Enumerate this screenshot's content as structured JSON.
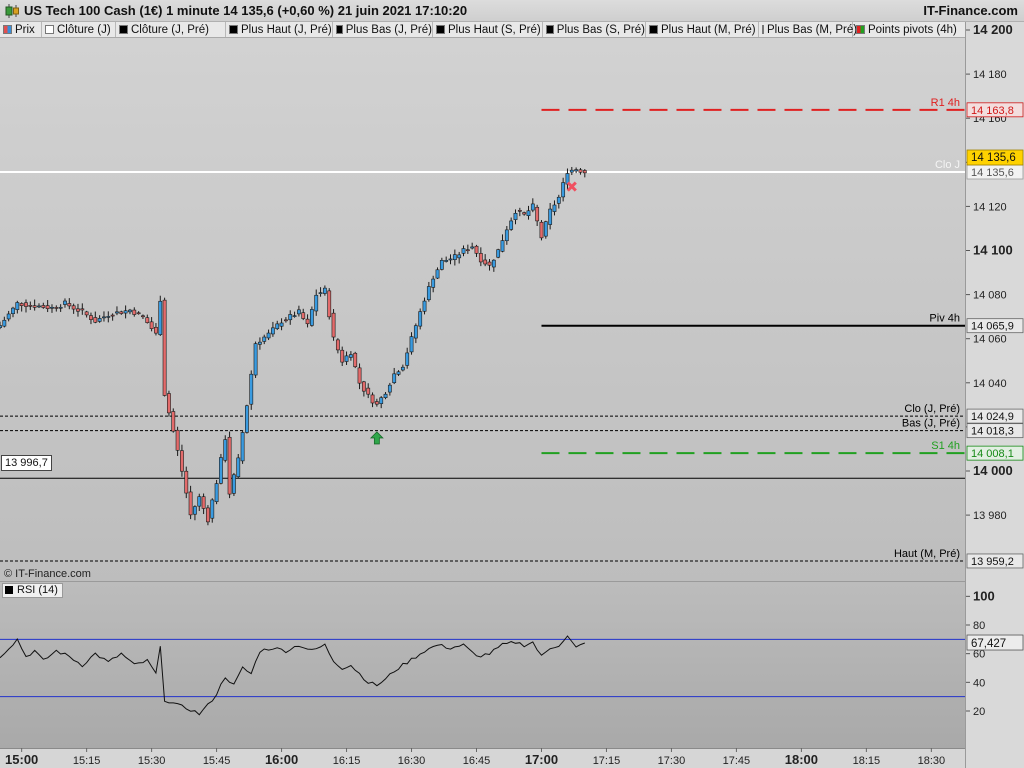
{
  "window": {
    "title": "US Tech 100 Cash (1€) 1 minute 14 135,6 (+0,60 %) 21 juin 2021 17:10:20",
    "brand": "IT-Finance.com",
    "copyright": "© IT-Finance.com"
  },
  "legend": [
    {
      "label": "Prix",
      "color": "#e05050",
      "color2": "#3a8fd8"
    },
    {
      "label": "Clôture (J)",
      "color": "#ffffff"
    },
    {
      "label": "Clôture (J, Pré)",
      "color": "#000000"
    },
    {
      "label": "Plus Haut (J, Pré)",
      "color": "#000000"
    },
    {
      "label": "Plus Bas (J, Pré)",
      "color": "#000000"
    },
    {
      "label": "Plus Haut (S, Pré)",
      "color": "#000000"
    },
    {
      "label": "Plus Bas (S, Pré)",
      "color": "#000000"
    },
    {
      "label": "Plus Haut (M, Pré)",
      "color": "#000000"
    },
    {
      "label": "Plus Bas (M, Pré)",
      "color": "#000000"
    },
    {
      "label": "Points pivots (4h)",
      "color": "#e02020",
      "color2": "#20a020"
    }
  ],
  "cursor_value": "13 996,7",
  "chart_data": [
    {
      "type": "candlestick",
      "series_name": "Prix",
      "x_unit": "time (HH:MM), 1 minute candles, 21 juin 2021",
      "ylim": [
        13950,
        14205
      ],
      "y_ticks": [
        13980,
        14000,
        14020,
        14040,
        14060,
        14080,
        14100,
        14120,
        14140,
        14160,
        14180,
        14200
      ],
      "y_tick_labels": [
        "13 980",
        "14 000",
        "14 020",
        "14 040",
        "14 060",
        "14 080",
        "14 100",
        "14 120",
        "14 140",
        "14 160",
        "14 180",
        "14 200"
      ],
      "x_range": [
        "14:55",
        "18:38"
      ],
      "x_ticks": [
        "15:00",
        "15:15",
        "15:30",
        "15:45",
        "16:00",
        "16:15",
        "16:30",
        "16:45",
        "17:00",
        "17:15",
        "17:30",
        "17:45",
        "18:00",
        "18:15",
        "18:30"
      ],
      "x_ticks_bold": [
        "15:00",
        "16:00",
        "17:00",
        "18:00"
      ],
      "anchors": [
        {
          "t": "14:55",
          "c": 14066
        },
        {
          "t": "14:59",
          "c": 14076
        },
        {
          "t": "15:03",
          "c": 14075
        },
        {
          "t": "15:07",
          "c": 14074
        },
        {
          "t": "15:10",
          "c": 14076
        },
        {
          "t": "15:14",
          "c": 14072
        },
        {
          "t": "15:17",
          "c": 14068
        },
        {
          "t": "15:20",
          "c": 14071
        },
        {
          "t": "15:25",
          "c": 14073
        },
        {
          "t": "15:28",
          "c": 14070
        },
        {
          "t": "15:31",
          "c": 14062
        },
        {
          "t": "15:32",
          "c": 14078
        },
        {
          "t": "15:33",
          "c": 14035
        },
        {
          "t": "15:35",
          "c": 14018
        },
        {
          "t": "15:37",
          "c": 14000
        },
        {
          "t": "15:39",
          "c": 13980
        },
        {
          "t": "15:41",
          "c": 13988
        },
        {
          "t": "15:43",
          "c": 13978
        },
        {
          "t": "15:45",
          "c": 13995
        },
        {
          "t": "15:47",
          "c": 14015
        },
        {
          "t": "15:48",
          "c": 13990
        },
        {
          "t": "15:50",
          "c": 14005
        },
        {
          "t": "15:52",
          "c": 14030
        },
        {
          "t": "15:54",
          "c": 14058
        },
        {
          "t": "15:57",
          "c": 14062
        },
        {
          "t": "16:00",
          "c": 14068
        },
        {
          "t": "16:04",
          "c": 14072
        },
        {
          "t": "16:06",
          "c": 14066
        },
        {
          "t": "16:08",
          "c": 14080
        },
        {
          "t": "16:10",
          "c": 14082
        },
        {
          "t": "16:12",
          "c": 14060
        },
        {
          "t": "16:14",
          "c": 14050
        },
        {
          "t": "16:16",
          "c": 14054
        },
        {
          "t": "16:18",
          "c": 14040
        },
        {
          "t": "16:20",
          "c": 14034
        },
        {
          "t": "16:22",
          "c": 14030
        },
        {
          "t": "16:24",
          "c": 14036
        },
        {
          "t": "16:26",
          "c": 14044
        },
        {
          "t": "16:28",
          "c": 14048
        },
        {
          "t": "16:30",
          "c": 14060
        },
        {
          "t": "16:33",
          "c": 14078
        },
        {
          "t": "16:35",
          "c": 14088
        },
        {
          "t": "16:37",
          "c": 14095
        },
        {
          "t": "16:40",
          "c": 14097
        },
        {
          "t": "16:42",
          "c": 14100
        },
        {
          "t": "16:44",
          "c": 14102
        },
        {
          "t": "16:46",
          "c": 14096
        },
        {
          "t": "16:48",
          "c": 14093
        },
        {
          "t": "16:50",
          "c": 14100
        },
        {
          "t": "16:52",
          "c": 14110
        },
        {
          "t": "16:54",
          "c": 14118
        },
        {
          "t": "16:56",
          "c": 14116
        },
        {
          "t": "16:58",
          "c": 14120
        },
        {
          "t": "17:00",
          "c": 14106
        },
        {
          "t": "17:02",
          "c": 14118
        },
        {
          "t": "17:04",
          "c": 14124
        },
        {
          "t": "17:06",
          "c": 14136
        },
        {
          "t": "17:08",
          "c": 14137
        },
        {
          "t": "17:10",
          "c": 14135.6
        }
      ],
      "horizontal_levels": [
        {
          "name": "R1 4h",
          "value": 14163.8,
          "value_label": "14 163,8",
          "color": "#e02020",
          "style": "dashed-thick",
          "from": "17:00"
        },
        {
          "name": "Clo J",
          "value": 14135.6,
          "value_label": "14 135,6",
          "color": "#ffffff",
          "style": "solid"
        },
        {
          "name": "Piv 4h",
          "value": 14065.9,
          "value_label": "14 065,9",
          "color": "#000000",
          "style": "solid",
          "from": "17:00"
        },
        {
          "name": "Clo (J, Pré)",
          "value": 14024.9,
          "value_label": "14 024,9",
          "color": "#000000",
          "style": "dashed-thin"
        },
        {
          "name": "Bas (J, Pré)",
          "value": 14018.3,
          "value_label": "14 018,3",
          "color": "#000000",
          "style": "dashed-thin"
        },
        {
          "name": "S1 4h",
          "value": 14008.1,
          "value_label": "14 008,1",
          "color": "#20a020",
          "style": "dashed-thick",
          "from": "17:00"
        },
        {
          "name": "Haut (M, Pré)",
          "value": 13959.2,
          "value_label": "13 959,2",
          "color": "#000000",
          "style": "dashed-thin"
        }
      ],
      "cursor_line": 13996.7,
      "last_price_label": "14 135,6",
      "signals": [
        {
          "type": "buy-arrow",
          "t": "16:22",
          "value": 14015
        },
        {
          "type": "sell-cross",
          "t": "17:07",
          "value": 14129
        }
      ]
    },
    {
      "type": "line",
      "series_name": "RSI (14)",
      "ylim": [
        0,
        100
      ],
      "y_ticks": [
        20,
        40,
        60,
        80,
        100
      ],
      "y_tick_labels": [
        "20",
        "40",
        "60",
        "80",
        "100"
      ],
      "bands": [
        30,
        70
      ],
      "last_value": 67.427,
      "last_value_label": "67,427",
      "anchors": [
        {
          "t": "14:55",
          "v": 58
        },
        {
          "t": "14:57",
          "v": 64
        },
        {
          "t": "14:59",
          "v": 70
        },
        {
          "t": "15:01",
          "v": 58
        },
        {
          "t": "15:03",
          "v": 62
        },
        {
          "t": "15:05",
          "v": 55
        },
        {
          "t": "15:08",
          "v": 62
        },
        {
          "t": "15:11",
          "v": 58
        },
        {
          "t": "15:14",
          "v": 52
        },
        {
          "t": "15:17",
          "v": 60
        },
        {
          "t": "15:20",
          "v": 54
        },
        {
          "t": "15:23",
          "v": 60
        },
        {
          "t": "15:26",
          "v": 52
        },
        {
          "t": "15:29",
          "v": 55
        },
        {
          "t": "15:31",
          "v": 46
        },
        {
          "t": "15:32",
          "v": 64
        },
        {
          "t": "15:33",
          "v": 28
        },
        {
          "t": "15:36",
          "v": 24
        },
        {
          "t": "15:39",
          "v": 21
        },
        {
          "t": "15:41",
          "v": 18
        },
        {
          "t": "15:43",
          "v": 24
        },
        {
          "t": "15:45",
          "v": 32
        },
        {
          "t": "15:47",
          "v": 44
        },
        {
          "t": "15:49",
          "v": 38
        },
        {
          "t": "15:51",
          "v": 50
        },
        {
          "t": "15:53",
          "v": 46
        },
        {
          "t": "15:55",
          "v": 62
        },
        {
          "t": "15:58",
          "v": 64
        },
        {
          "t": "16:01",
          "v": 62
        },
        {
          "t": "16:04",
          "v": 66
        },
        {
          "t": "16:07",
          "v": 62
        },
        {
          "t": "16:10",
          "v": 66
        },
        {
          "t": "16:12",
          "v": 55
        },
        {
          "t": "16:14",
          "v": 50
        },
        {
          "t": "16:16",
          "v": 52
        },
        {
          "t": "16:18",
          "v": 46
        },
        {
          "t": "16:20",
          "v": 40
        },
        {
          "t": "16:22",
          "v": 38
        },
        {
          "t": "16:24",
          "v": 42
        },
        {
          "t": "16:26",
          "v": 48
        },
        {
          "t": "16:28",
          "v": 52
        },
        {
          "t": "16:30",
          "v": 56
        },
        {
          "t": "16:33",
          "v": 62
        },
        {
          "t": "16:36",
          "v": 66
        },
        {
          "t": "16:39",
          "v": 64
        },
        {
          "t": "16:42",
          "v": 66
        },
        {
          "t": "16:45",
          "v": 58
        },
        {
          "t": "16:48",
          "v": 60
        },
        {
          "t": "16:51",
          "v": 66
        },
        {
          "t": "16:54",
          "v": 68
        },
        {
          "t": "16:56",
          "v": 66
        },
        {
          "t": "16:58",
          "v": 68
        },
        {
          "t": "17:00",
          "v": 58
        },
        {
          "t": "17:02",
          "v": 64
        },
        {
          "t": "17:04",
          "v": 66
        },
        {
          "t": "17:06",
          "v": 72
        },
        {
          "t": "17:08",
          "v": 64
        },
        {
          "t": "17:10",
          "v": 67.427
        }
      ]
    }
  ]
}
